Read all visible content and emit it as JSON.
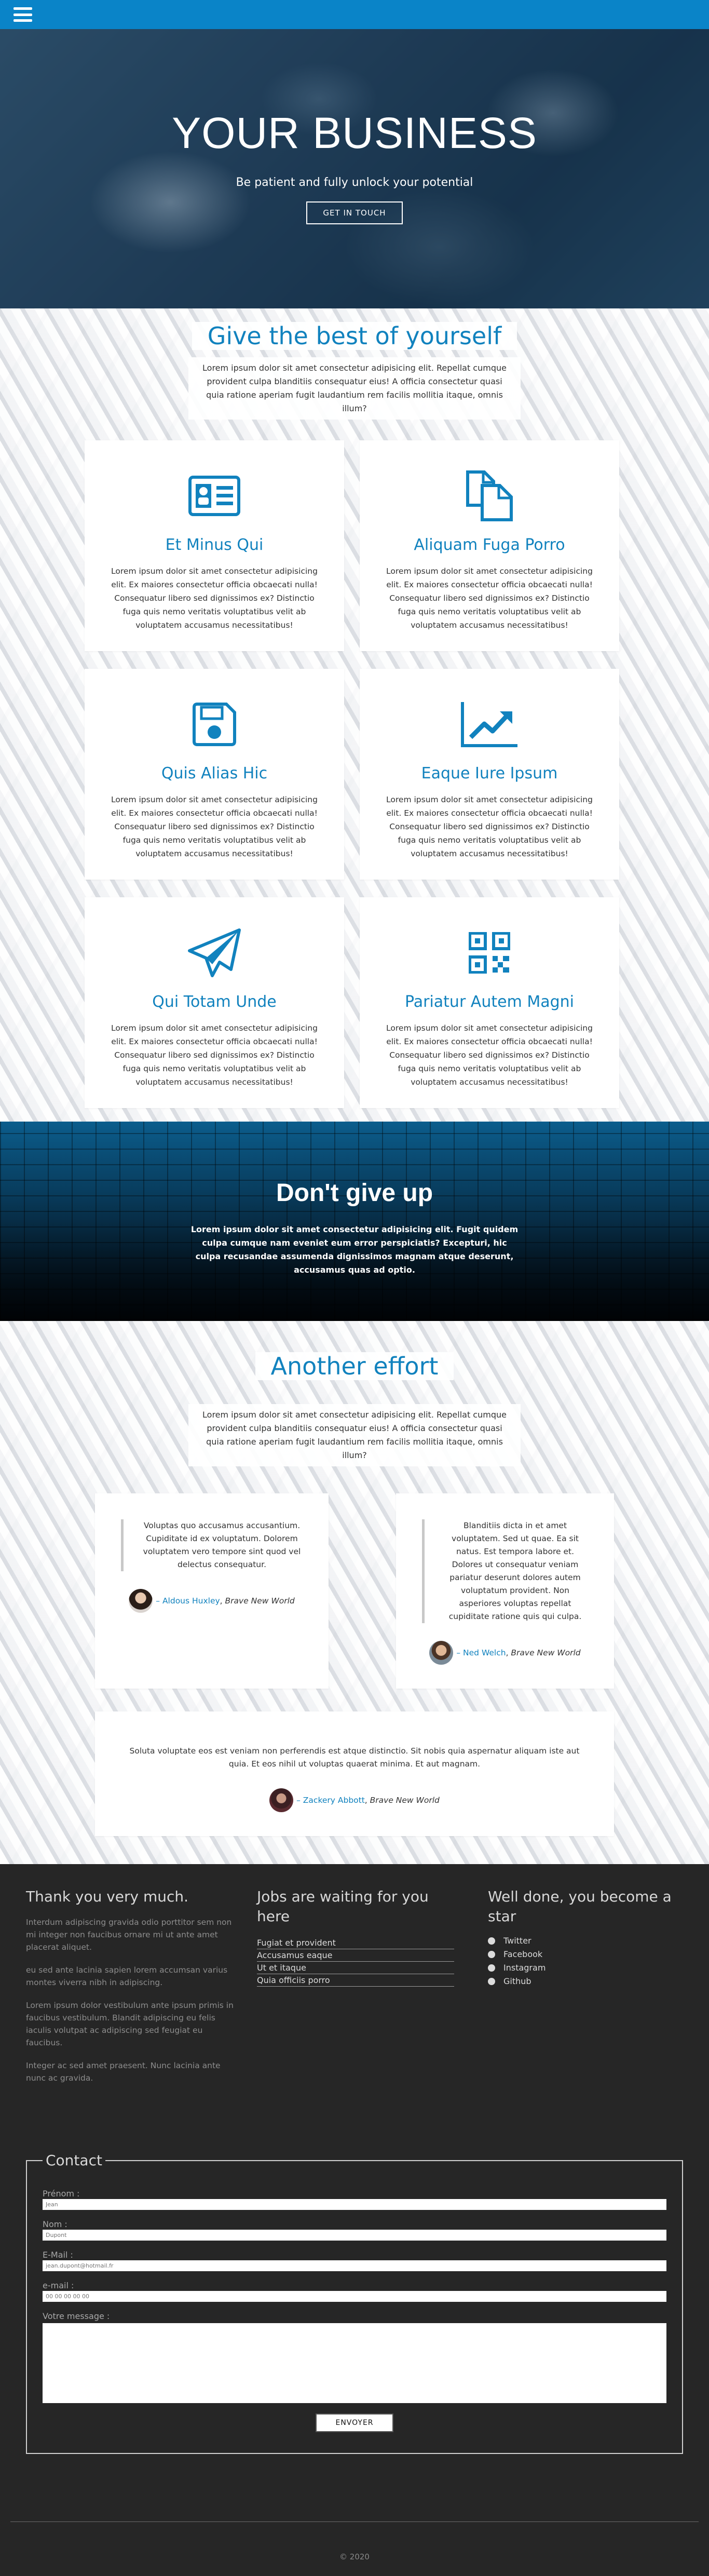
{
  "nav": {
    "menu_icon": "hamburger-menu-icon"
  },
  "hero": {
    "title": "YOUR BUSINESS",
    "subtitle": "Be patient and fully unlock your potential",
    "cta_label": "GET IN TOUCH"
  },
  "best": {
    "title": "Give the best of yourself",
    "intro": "Lorem ipsum dolor sit amet consectetur adipisicing elit. Repellat cumque provident culpa blanditiis consequatur eius! A officia consectetur quasi quia ratione aperiam fugit laudantium rem facilis mollitia itaque, omnis illum?",
    "features": [
      {
        "icon": "id-card-icon",
        "title": "Et Minus Qui",
        "text": "Lorem ipsum dolor sit amet consectetur adipisicing elit. Ex maiores consectetur officia obcaecati nulla! Consequatur libero sed dignissimos ex? Distinctio fuga quis nemo veritatis voluptatibus velit ab voluptatem accusamus necessitatibus!"
      },
      {
        "icon": "copy-documents-icon",
        "title": "Aliquam Fuga Porro",
        "text": "Lorem ipsum dolor sit amet consectetur adipisicing elit. Ex maiores consectetur officia obcaecati nulla! Consequatur libero sed dignissimos ex? Distinctio fuga quis nemo veritatis voluptatibus velit ab voluptatem accusamus necessitatibus!"
      },
      {
        "icon": "floppy-disk-icon",
        "title": "Quis Alias Hic",
        "text": "Lorem ipsum dolor sit amet consectetur adipisicing elit. Ex maiores consectetur officia obcaecati nulla! Consequatur libero sed dignissimos ex? Distinctio fuga quis nemo veritatis voluptatibus velit ab voluptatem accusamus necessitatibus!"
      },
      {
        "icon": "trending-chart-icon",
        "title": "Eaque Iure Ipsum",
        "text": "Lorem ipsum dolor sit amet consectetur adipisicing elit. Ex maiores consectetur officia obcaecati nulla! Consequatur libero sed dignissimos ex? Distinctio fuga quis nemo veritatis voluptatibus velit ab voluptatem accusamus necessitatibus!"
      },
      {
        "icon": "paper-plane-icon",
        "title": "Qui Totam Unde",
        "text": "Lorem ipsum dolor sit amet consectetur adipisicing elit. Ex maiores consectetur officia obcaecati nulla! Consequatur libero sed dignissimos ex? Distinctio fuga quis nemo veritatis voluptatibus velit ab voluptatem accusamus necessitatibus!"
      },
      {
        "icon": "qr-code-icon",
        "title": "Pariatur Autem Magni",
        "text": "Lorem ipsum dolor sit amet consectetur adipisicing elit. Ex maiores consectetur officia obcaecati nulla! Consequatur libero sed dignissimos ex? Distinctio fuga quis nemo veritatis voluptatibus velit ab voluptatem accusamus necessitatibus!"
      }
    ]
  },
  "dontgiveup": {
    "title": "Don't give up",
    "text": "Lorem ipsum dolor sit amet consectetur adipisicing elit. Fugit quidem culpa cumque nam eveniet eum error perspiciatis? Excepturi, hic culpa recusandae assumenda dignissimos magnam atque deserunt, accusamus quas ad optio."
  },
  "effort": {
    "title": "Another effort",
    "intro": "Lorem ipsum dolor sit amet consectetur adipisicing elit. Repellat cumque provident culpa blanditiis consequatur eius! A officia consectetur quasi quia ratione aperiam fugit laudantium rem facilis mollitia itaque, omnis illum?",
    "testimonials": [
      {
        "quote": "Voluptas quo accusamus accusantium. Cupiditate id ex voluptatum. Dolorem voluptatem vero tempore sint quod vel delectus consequatur.",
        "author": "– Aldous Huxley",
        "work": "Brave New World"
      },
      {
        "quote": "Blanditiis dicta in et amet voluptatem. Sed ut quae. Ea sit natus. Est tempora labore et. Dolores ut consequatur veniam pariatur deserunt dolores autem voluptatum provident. Non asperiores voluptas repellat cupiditate ratione quis qui culpa.",
        "author": "– Ned Welch",
        "work": "Brave New World"
      },
      {
        "quote": "Soluta voluptate eos est veniam non perferendis est atque distinctio. Sit nobis quia aspernatur aliquam iste aut quia. Et eos nihil ut voluptas quaerat minima. Et aut magnam.",
        "author": "– Zackery Abbott",
        "work": "Brave New World"
      }
    ]
  },
  "footer": {
    "col1_title": "Thank you very much.",
    "col1_paragraphs": [
      "Interdum adipiscing gravida odio porttitor sem non mi integer non faucibus ornare mi ut ante amet placerat aliquet.",
      "eu sed ante lacinia sapien lorem accumsan varius montes viverra nibh in adipiscing.",
      "Lorem ipsum dolor vestibulum ante ipsum primis in faucibus vestibulum. Blandit adipiscing eu felis iaculis volutpat ac adipiscing sed feugiat eu faucibus.",
      "Integer ac sed amet praesent. Nunc lacinia ante nunc ac gravida."
    ],
    "col2_title": "Jobs are waiting for you here",
    "jobs": [
      "Fugiat et provident",
      "Accusamus eaque",
      "Ut et itaque",
      "Quia officiis porro"
    ],
    "col3_title": "Well done, you become a star",
    "social": [
      "Twitter",
      "Facebook",
      "Instagram",
      "Github"
    ],
    "copyright": "© 2020"
  },
  "contact": {
    "legend": "Contact",
    "firstname_label": "Prénom :",
    "firstname_value": "Jean",
    "lastname_label": "Nom :",
    "lastname_value": "Dupont",
    "email_label": "E-Mail :",
    "email_value": "jean.dupont@hotmail.fr",
    "phone_label": "e-mail :",
    "phone_value": "00 00 00 00 00",
    "message_label": "Votre message :",
    "submit_label": "ENVOYER"
  },
  "colors": {
    "accent": "#1182be",
    "topbar": "#0a84c8",
    "footer_bg": "#262626"
  }
}
